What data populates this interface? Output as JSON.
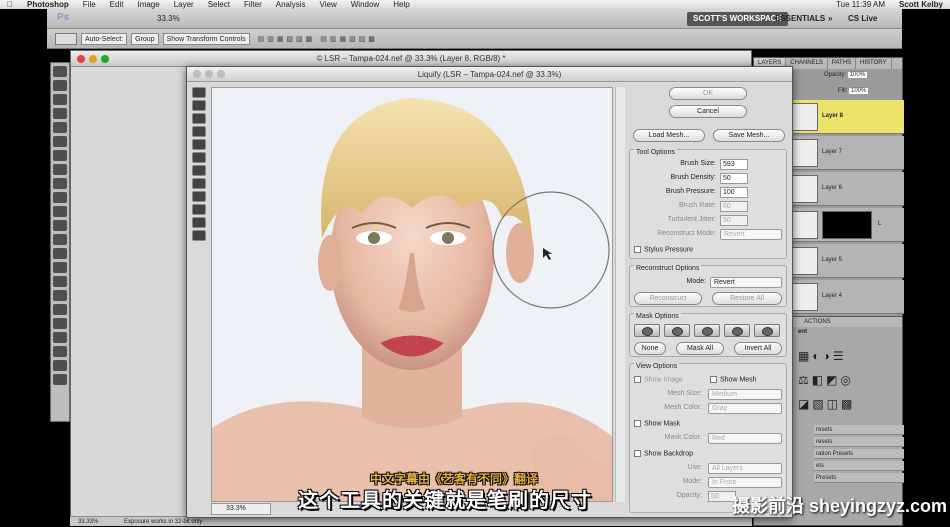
{
  "menubar": {
    "app": "Photoshop",
    "items": [
      "File",
      "Edit",
      "Image",
      "Layer",
      "Select",
      "Filter",
      "Analysis",
      "View",
      "Window",
      "Help"
    ],
    "clock": "Tue 11:39 AM",
    "user": "Scott Kelby"
  },
  "appbar": {
    "zoom": "33.3%",
    "workspace": "SCOTT'S WORKSPACE",
    "essentials": "ESSENTIALS",
    "chevron": "»",
    "cslive": "CS Live"
  },
  "optbar": {
    "auto_select": "Auto-Select:",
    "group": "Group",
    "transform": "Show Transform Controls"
  },
  "document": {
    "title": "© LSR – Tampa-024.nef @ 33.3% (Layer 8, RGB/8) *"
  },
  "liquify": {
    "title": "Liquify (LSR – Tampa-024.nef @ 33.3%)",
    "zoom": "33.3%",
    "ok": "OK",
    "cancel": "Cancel",
    "load_mesh": "Load Mesh...",
    "save_mesh": "Save Mesh...",
    "tool_options": {
      "title": "Tool Options",
      "brush_size_label": "Brush Size:",
      "brush_size": "593",
      "brush_density_label": "Brush Density:",
      "brush_density": "50",
      "brush_pressure_label": "Brush Pressure:",
      "brush_pressure": "100",
      "brush_rate_label": "Brush Rate:",
      "brush_rate": "80",
      "turbulent_label": "Turbulent Jitter:",
      "turbulent": "50",
      "reconstruct_mode_label": "Reconstruct Mode:",
      "reconstruct_mode": "Revert",
      "stylus": "Stylus Pressure"
    },
    "reconstruct_options": {
      "title": "Reconstruct Options",
      "mode_label": "Mode:",
      "mode": "Revert",
      "reconstruct": "Reconstruct",
      "restore_all": "Restore All"
    },
    "mask_options": {
      "title": "Mask Options",
      "none": "None",
      "mask_all": "Mask All",
      "invert_all": "Invert All"
    },
    "view_options": {
      "title": "View Options",
      "show_image": "Show Image",
      "show_mesh": "Show Mesh",
      "mesh_size_label": "Mesh Size:",
      "mesh_size": "Medium",
      "mesh_color_label": "Mesh Color:",
      "mesh_color": "Gray",
      "show_mask": "Show Mask",
      "mask_color_label": "Mask Color:",
      "mask_color": "Red",
      "show_backdrop": "Show Backdrop",
      "use_label": "Use:",
      "use": "All Layers",
      "mode_label": "Mode:",
      "mode": "In Front",
      "opacity_label": "Opacity:",
      "opacity": "50"
    }
  },
  "layers_panel": {
    "tabs": [
      "LAYERS",
      "CHANNELS",
      "PATHS",
      "HISTORY"
    ],
    "opacity_label": "Opacity:",
    "opacity": "100%",
    "fill_label": "Fill:",
    "fill": "100%",
    "layers": [
      "Layer 8",
      "Layer 7",
      "Layer 6",
      "Layer 5",
      "Layer 4"
    ],
    "hidden_layer": "L"
  },
  "actions_panel": {
    "tab": "ACTIONS",
    "partial": "ent",
    "presets": [
      "resets",
      "resets",
      "ration Presets",
      "ets",
      "Presets"
    ]
  },
  "status": {
    "zoom": "33.33%",
    "message": "Exposure works in 32-bit only"
  },
  "subtitles": {
    "credit": "中文字幕由《艺客有不同》翻译",
    "line": "这个工具的关键就是笔刷的尺寸"
  },
  "watermark": "摄影前沿 sheyingzyz.com"
}
